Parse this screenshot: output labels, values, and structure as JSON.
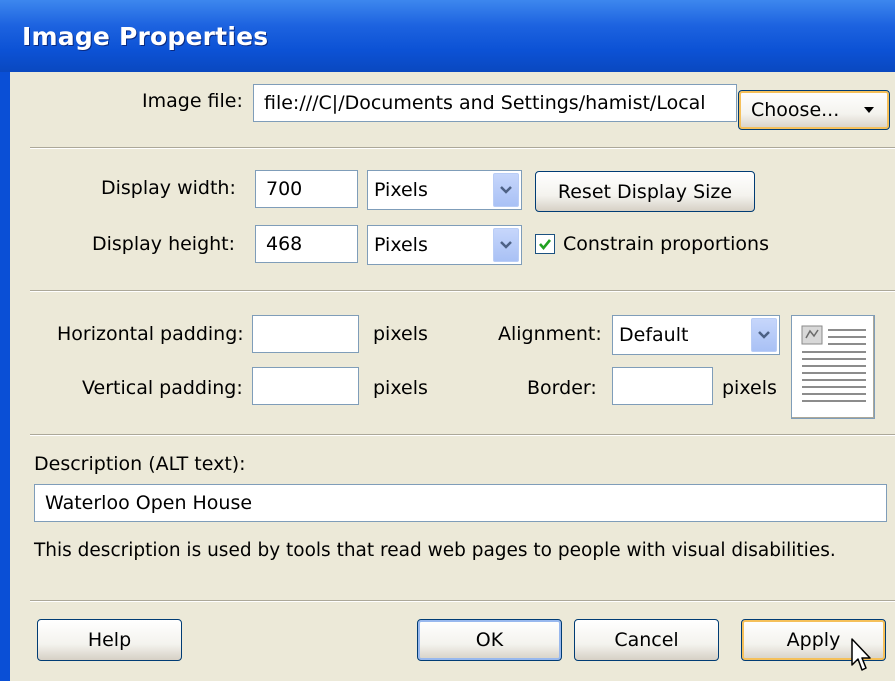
{
  "window": {
    "title": "Image Properties"
  },
  "image_file": {
    "label": "Image file:",
    "value": "file:///C|/Documents and Settings/hamist/Local",
    "choose_label": "Choose..."
  },
  "display": {
    "width_label": "Display width:",
    "width_value": "700",
    "width_unit": "Pixels",
    "height_label": "Display height:",
    "height_value": "468",
    "height_unit": "Pixels",
    "reset_label": "Reset Display Size",
    "constrain_label": "Constrain proportions",
    "constrain_checked": true
  },
  "layout": {
    "hpad_label": "Horizontal padding:",
    "hpad_value": "",
    "hpad_unit": "pixels",
    "vpad_label": "Vertical padding:",
    "vpad_value": "",
    "vpad_unit": "pixels",
    "alignment_label": "Alignment:",
    "alignment_value": "Default",
    "border_label": "Border:",
    "border_value": "",
    "border_unit": "pixels",
    "preview_icon": "alignment-preview-icon"
  },
  "description": {
    "label": "Description (ALT text):",
    "value": "Waterloo Open House",
    "help_text": "This description is used by tools that read web pages to people with visual disabilities."
  },
  "buttons": {
    "help": "Help",
    "ok": "OK",
    "cancel": "Cancel",
    "apply": "Apply"
  },
  "colors": {
    "title_bar": "#0a4fd6",
    "dialog_bg": "#ece9d8",
    "button_border": "#003c74",
    "hot_outline": "#f5c05a",
    "check_green": "#21a121"
  }
}
